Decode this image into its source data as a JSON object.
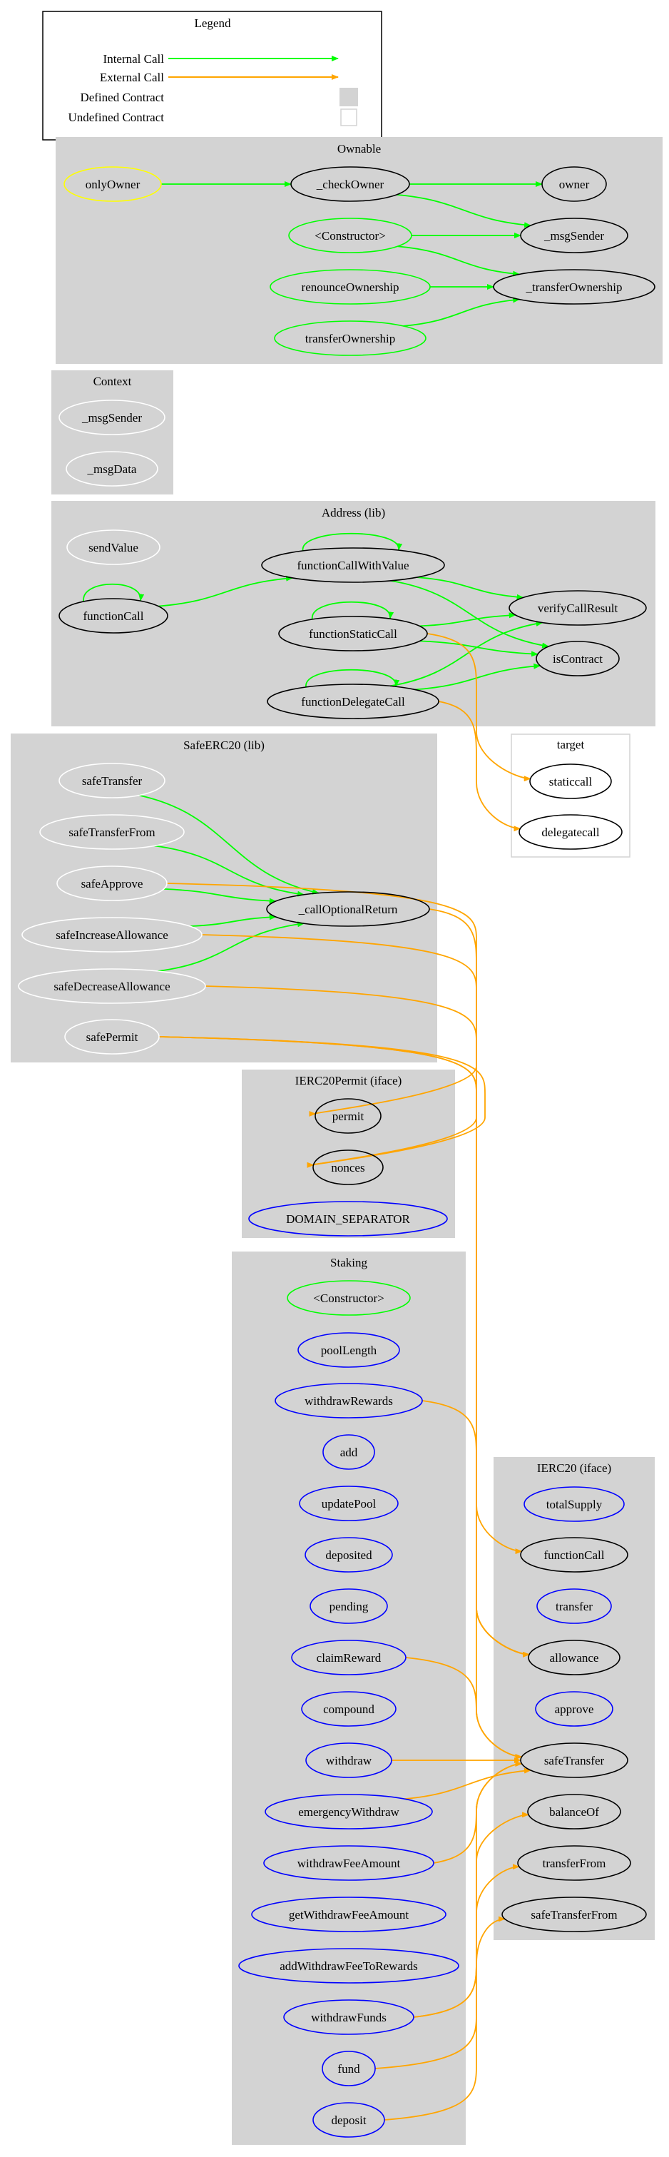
{
  "colors": {
    "internal_call": "#00ff00",
    "external_call": "#ffa500",
    "defined_contract_fill": "#d3d3d3",
    "undefined_contract_border": "#d3d3d3",
    "modifier": "#ffff00",
    "constructor": "#00ff00",
    "public_function": "#0000ff",
    "internal_function": "#000000",
    "library_function": "#ffffff"
  },
  "legend": {
    "title": "Legend",
    "items": [
      {
        "label": "Internal Call",
        "kind": "internal-arrow"
      },
      {
        "label": "External Call",
        "kind": "external-arrow"
      },
      {
        "label": "Defined Contract",
        "kind": "defined-box"
      },
      {
        "label": "Undefined Contract",
        "kind": "undefined-box"
      }
    ]
  },
  "clusters": [
    {
      "id": "Ownable",
      "title": "Ownable",
      "defined": true
    },
    {
      "id": "Context",
      "title": "Context",
      "defined": true
    },
    {
      "id": "Address",
      "title": "Address  (lib)",
      "defined": true
    },
    {
      "id": "target",
      "title": "target",
      "defined": false
    },
    {
      "id": "SafeERC20",
      "title": "SafeERC20  (lib)",
      "defined": true
    },
    {
      "id": "IERC20Permit",
      "title": "IERC20Permit  (iface)",
      "defined": true
    },
    {
      "id": "Staking",
      "title": "Staking",
      "defined": true
    },
    {
      "id": "IERC20",
      "title": "IERC20  (iface)",
      "defined": true
    }
  ],
  "nodes": [
    {
      "id": "Ownable.onlyOwner",
      "label": "onlyOwner",
      "role": "modifier"
    },
    {
      "id": "Ownable._checkOwner",
      "label": "_checkOwner",
      "role": "internal_function"
    },
    {
      "id": "Ownable.owner",
      "label": "owner",
      "role": "internal_function"
    },
    {
      "id": "Ownable._msgSender",
      "label": "_msgSender",
      "role": "internal_function"
    },
    {
      "id": "Ownable.constructor",
      "label": "<Constructor>",
      "role": "constructor"
    },
    {
      "id": "Ownable._transferOwnership",
      "label": "_transferOwnership",
      "role": "internal_function"
    },
    {
      "id": "Ownable.renounceOwnership",
      "label": "renounceOwnership",
      "role": "constructor"
    },
    {
      "id": "Ownable.transferOwnership",
      "label": "transferOwnership",
      "role": "constructor"
    },
    {
      "id": "Context._msgSender",
      "label": "_msgSender",
      "role": "library_function"
    },
    {
      "id": "Context._msgData",
      "label": "_msgData",
      "role": "library_function"
    },
    {
      "id": "Address.sendValue",
      "label": "sendValue",
      "role": "library_function"
    },
    {
      "id": "Address.functionCallWithValue",
      "label": "functionCallWithValue",
      "role": "internal_function"
    },
    {
      "id": "Address.functionCall",
      "label": "functionCall",
      "role": "internal_function"
    },
    {
      "id": "Address.functionStaticCall",
      "label": "functionStaticCall",
      "role": "internal_function"
    },
    {
      "id": "Address.verifyCallResult",
      "label": "verifyCallResult",
      "role": "internal_function"
    },
    {
      "id": "Address.isContract",
      "label": "isContract",
      "role": "internal_function"
    },
    {
      "id": "Address.functionDelegateCall",
      "label": "functionDelegateCall",
      "role": "internal_function"
    },
    {
      "id": "target.staticcall",
      "label": "staticcall",
      "role": "internal_function"
    },
    {
      "id": "target.delegatecall",
      "label": "delegatecall",
      "role": "internal_function"
    },
    {
      "id": "SafeERC20.safeTransfer",
      "label": "safeTransfer",
      "role": "library_function"
    },
    {
      "id": "SafeERC20.safeTransferFrom",
      "label": "safeTransferFrom",
      "role": "library_function"
    },
    {
      "id": "SafeERC20.safeApprove",
      "label": "safeApprove",
      "role": "library_function"
    },
    {
      "id": "SafeERC20.safeIncreaseAllowance",
      "label": "safeIncreaseAllowance",
      "role": "library_function"
    },
    {
      "id": "SafeERC20.safeDecreaseAllowance",
      "label": "safeDecreaseAllowance",
      "role": "library_function"
    },
    {
      "id": "SafeERC20.safePermit",
      "label": "safePermit",
      "role": "library_function"
    },
    {
      "id": "SafeERC20._callOptionalReturn",
      "label": "_callOptionalReturn",
      "role": "internal_function"
    },
    {
      "id": "IERC20Permit.permit",
      "label": "permit",
      "role": "internal_function"
    },
    {
      "id": "IERC20Permit.nonces",
      "label": "nonces",
      "role": "internal_function"
    },
    {
      "id": "IERC20Permit.DOMAIN_SEPARATOR",
      "label": "DOMAIN_SEPARATOR",
      "role": "public_function"
    },
    {
      "id": "Staking.constructor",
      "label": "<Constructor>",
      "role": "constructor"
    },
    {
      "id": "Staking.poolLength",
      "label": "poolLength",
      "role": "public_function"
    },
    {
      "id": "Staking.withdrawRewards",
      "label": "withdrawRewards",
      "role": "public_function"
    },
    {
      "id": "Staking.add",
      "label": "add",
      "role": "public_function"
    },
    {
      "id": "Staking.updatePool",
      "label": "updatePool",
      "role": "public_function"
    },
    {
      "id": "Staking.deposited",
      "label": "deposited",
      "role": "public_function"
    },
    {
      "id": "Staking.pending",
      "label": "pending",
      "role": "public_function"
    },
    {
      "id": "Staking.claimReward",
      "label": "claimReward",
      "role": "public_function"
    },
    {
      "id": "Staking.compound",
      "label": "compound",
      "role": "public_function"
    },
    {
      "id": "Staking.withdraw",
      "label": "withdraw",
      "role": "public_function"
    },
    {
      "id": "Staking.emergencyWithdraw",
      "label": "emergencyWithdraw",
      "role": "public_function"
    },
    {
      "id": "Staking.withdrawFeeAmount",
      "label": "withdrawFeeAmount",
      "role": "public_function"
    },
    {
      "id": "Staking.getWithdrawFeeAmount",
      "label": "getWithdrawFeeAmount",
      "role": "public_function"
    },
    {
      "id": "Staking.addWithdrawFeeToRewards",
      "label": "addWithdrawFeeToRewards",
      "role": "public_function"
    },
    {
      "id": "Staking.withdrawFunds",
      "label": "withdrawFunds",
      "role": "public_function"
    },
    {
      "id": "Staking.fund",
      "label": "fund",
      "role": "public_function"
    },
    {
      "id": "Staking.deposit",
      "label": "deposit",
      "role": "public_function"
    },
    {
      "id": "IERC20.totalSupply",
      "label": "totalSupply",
      "role": "public_function"
    },
    {
      "id": "IERC20.functionCall",
      "label": "functionCall",
      "role": "internal_function"
    },
    {
      "id": "IERC20.transfer",
      "label": "transfer",
      "role": "public_function"
    },
    {
      "id": "IERC20.allowance",
      "label": "allowance",
      "role": "internal_function"
    },
    {
      "id": "IERC20.approve",
      "label": "approve",
      "role": "public_function"
    },
    {
      "id": "IERC20.safeTransfer",
      "label": "safeTransfer",
      "role": "internal_function"
    },
    {
      "id": "IERC20.balanceOf",
      "label": "balanceOf",
      "role": "internal_function"
    },
    {
      "id": "IERC20.transferFrom",
      "label": "transferFrom",
      "role": "internal_function"
    },
    {
      "id": "IERC20.safeTransferFrom",
      "label": "safeTransferFrom",
      "role": "internal_function"
    }
  ],
  "edges": [
    {
      "from": "Ownable.onlyOwner",
      "to": "Ownable._checkOwner",
      "type": "internal"
    },
    {
      "from": "Ownable._checkOwner",
      "to": "Ownable.owner",
      "type": "internal"
    },
    {
      "from": "Ownable._checkOwner",
      "to": "Ownable._msgSender",
      "type": "internal"
    },
    {
      "from": "Ownable.constructor",
      "to": "Ownable._msgSender",
      "type": "internal"
    },
    {
      "from": "Ownable.constructor",
      "to": "Ownable._transferOwnership",
      "type": "internal"
    },
    {
      "from": "Ownable.renounceOwnership",
      "to": "Ownable._transferOwnership",
      "type": "internal"
    },
    {
      "from": "Ownable.transferOwnership",
      "to": "Ownable._transferOwnership",
      "type": "internal"
    },
    {
      "from": "Address.functionCall",
      "to": "Address.functionCall",
      "type": "internal"
    },
    {
      "from": "Address.functionCall",
      "to": "Address.functionCallWithValue",
      "type": "internal"
    },
    {
      "from": "Address.functionCallWithValue",
      "to": "Address.functionCallWithValue",
      "type": "internal"
    },
    {
      "from": "Address.functionCallWithValue",
      "to": "Address.verifyCallResult",
      "type": "internal"
    },
    {
      "from": "Address.functionCallWithValue",
      "to": "Address.isContract",
      "type": "internal"
    },
    {
      "from": "Address.functionStaticCall",
      "to": "Address.functionStaticCall",
      "type": "internal"
    },
    {
      "from": "Address.functionStaticCall",
      "to": "Address.verifyCallResult",
      "type": "internal"
    },
    {
      "from": "Address.functionStaticCall",
      "to": "Address.isContract",
      "type": "internal"
    },
    {
      "from": "Address.functionDelegateCall",
      "to": "Address.functionDelegateCall",
      "type": "internal"
    },
    {
      "from": "Address.functionDelegateCall",
      "to": "Address.verifyCallResult",
      "type": "internal"
    },
    {
      "from": "Address.functionDelegateCall",
      "to": "Address.isContract",
      "type": "internal"
    },
    {
      "from": "Address.functionStaticCall",
      "to": "target.staticcall",
      "type": "external"
    },
    {
      "from": "Address.functionDelegateCall",
      "to": "target.delegatecall",
      "type": "external"
    },
    {
      "from": "SafeERC20.safeTransfer",
      "to": "SafeERC20._callOptionalReturn",
      "type": "internal"
    },
    {
      "from": "SafeERC20.safeTransferFrom",
      "to": "SafeERC20._callOptionalReturn",
      "type": "internal"
    },
    {
      "from": "SafeERC20.safeApprove",
      "to": "SafeERC20._callOptionalReturn",
      "type": "internal"
    },
    {
      "from": "SafeERC20.safeIncreaseAllowance",
      "to": "SafeERC20._callOptionalReturn",
      "type": "internal"
    },
    {
      "from": "SafeERC20.safeDecreaseAllowance",
      "to": "SafeERC20._callOptionalReturn",
      "type": "internal"
    },
    {
      "from": "SafeERC20._callOptionalReturn",
      "to": "IERC20.functionCall",
      "type": "external"
    },
    {
      "from": "SafeERC20.safeApprove",
      "to": "IERC20.allowance",
      "type": "external"
    },
    {
      "from": "SafeERC20.safeIncreaseAllowance",
      "to": "IERC20.allowance",
      "type": "external"
    },
    {
      "from": "SafeERC20.safeDecreaseAllowance",
      "to": "IERC20.allowance",
      "type": "external"
    },
    {
      "from": "SafeERC20.safePermit",
      "to": "IERC20Permit.permit",
      "type": "external"
    },
    {
      "from": "SafeERC20.safePermit",
      "to": "IERC20Permit.nonces",
      "type": "external"
    },
    {
      "from": "SafeERC20.safePermit",
      "to": "IERC20Permit.nonces",
      "type": "external"
    },
    {
      "from": "Staking.withdrawRewards",
      "to": "IERC20.safeTransfer",
      "type": "external"
    },
    {
      "from": "Staking.claimReward",
      "to": "IERC20.safeTransfer",
      "type": "external"
    },
    {
      "from": "Staking.withdraw",
      "to": "IERC20.safeTransfer",
      "type": "external"
    },
    {
      "from": "Staking.emergencyWithdraw",
      "to": "IERC20.safeTransfer",
      "type": "external"
    },
    {
      "from": "Staking.withdrawFeeAmount",
      "to": "IERC20.safeTransfer",
      "type": "external"
    },
    {
      "from": "Staking.withdrawFunds",
      "to": "IERC20.safeTransfer",
      "type": "external"
    },
    {
      "from": "Staking.withdrawFunds",
      "to": "IERC20.balanceOf",
      "type": "external"
    },
    {
      "from": "Staking.fund",
      "to": "IERC20.transferFrom",
      "type": "external"
    },
    {
      "from": "Staking.deposit",
      "to": "IERC20.safeTransferFrom",
      "type": "external"
    }
  ]
}
